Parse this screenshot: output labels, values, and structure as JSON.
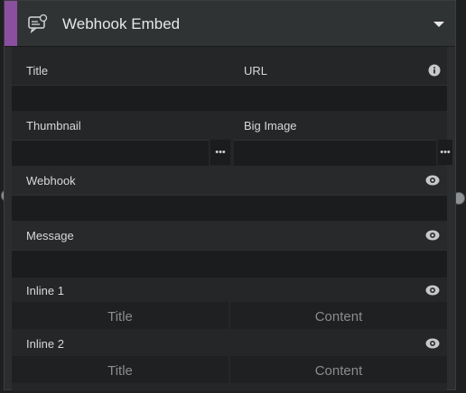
{
  "node": {
    "title": "Webhook Embed",
    "accent_color": "#8b4fa0"
  },
  "fields": {
    "title_label": "Title",
    "url_label": "URL",
    "thumbnail_label": "Thumbnail",
    "big_image_label": "Big Image",
    "webhook_label": "Webhook",
    "message_label": "Message",
    "browse_dots": "•••"
  },
  "inlines": [
    {
      "label": "Inline 1",
      "title_placeholder": "Title",
      "content_placeholder": "Content"
    },
    {
      "label": "Inline 2",
      "title_placeholder": "Title",
      "content_placeholder": "Content"
    }
  ],
  "icons": {
    "header": "chat-bubble-icon",
    "dropdown": "caret-down-icon",
    "info": "info-icon",
    "visibility": "eye-icon"
  }
}
